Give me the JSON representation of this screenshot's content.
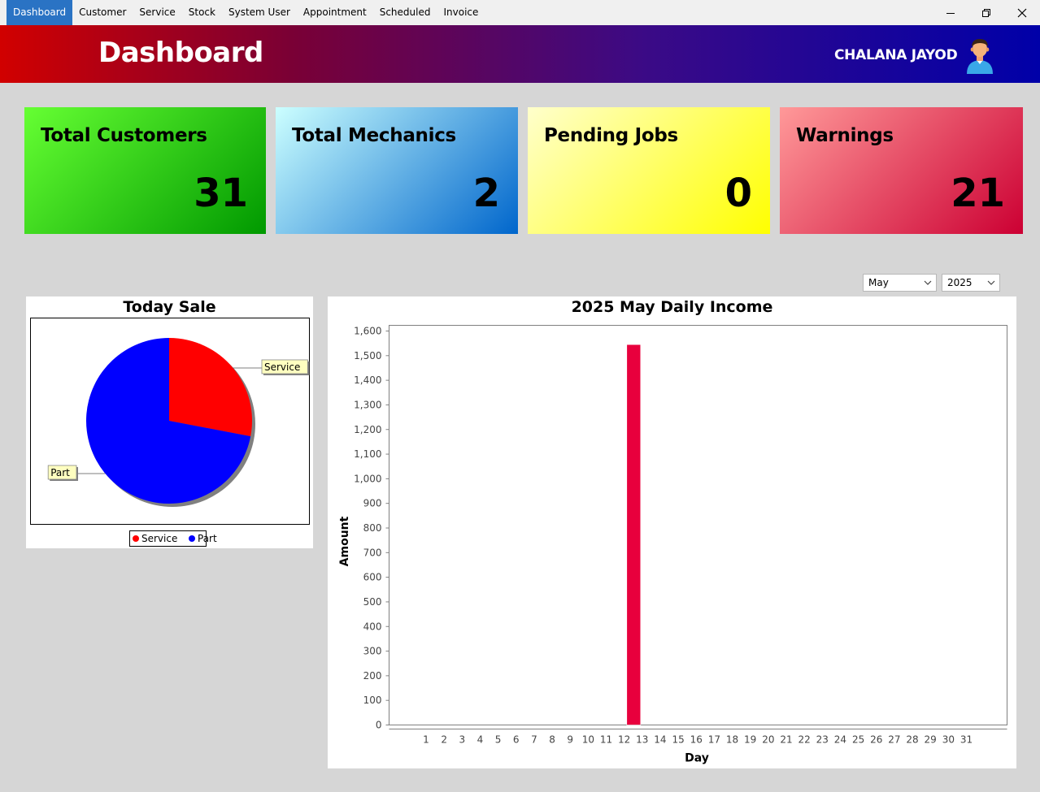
{
  "menu": {
    "items": [
      "Dashboard",
      "Customer",
      "Service",
      "Stock",
      "System User",
      "Appointment",
      "Scheduled",
      "Invoice"
    ],
    "active_index": 0
  },
  "window_controls": {
    "minimize_icon": "minimize-icon",
    "restore_icon": "restore-icon",
    "close_icon": "close-icon"
  },
  "header": {
    "title": "Dashboard",
    "user_name": "CHALANA JAYOD",
    "avatar_icon": "user-avatar-icon"
  },
  "cards": {
    "customers": {
      "label": "Total Customers",
      "value": "31"
    },
    "mechanics": {
      "label": "Total Mechanics",
      "value": "2"
    },
    "pending": {
      "label": "Pending Jobs",
      "value": "0"
    },
    "warnings": {
      "label": "Warnings",
      "value": "21"
    }
  },
  "filters": {
    "month": "May",
    "year": "2025"
  },
  "chart_data": [
    {
      "type": "pie",
      "title": "Today Sale",
      "slices": [
        {
          "name": "Service",
          "value": 28,
          "color": "#ff0000"
        },
        {
          "name": "Part",
          "value": 72,
          "color": "#0000ff"
        }
      ],
      "legend": [
        "Service",
        "Part"
      ],
      "legend_placement": "bottom"
    },
    {
      "type": "bar",
      "title": "2025 May Daily Income",
      "xlabel": "Day",
      "ylabel": "Amount",
      "categories": [
        "1",
        "2",
        "3",
        "4",
        "5",
        "6",
        "7",
        "8",
        "9",
        "10",
        "11",
        "12",
        "13",
        "14",
        "15",
        "16",
        "17",
        "18",
        "19",
        "20",
        "21",
        "22",
        "23",
        "24",
        "25",
        "26",
        "27",
        "28",
        "29",
        "30",
        "31"
      ],
      "values": [
        0,
        0,
        0,
        0,
        0,
        0,
        0,
        0,
        0,
        0,
        0,
        0,
        1545,
        0,
        0,
        0,
        0,
        0,
        0,
        0,
        0,
        0,
        0,
        0,
        0,
        0,
        0,
        0,
        0,
        0,
        0
      ],
      "ylim": [
        0,
        1600
      ],
      "yticks": [
        "0",
        "100",
        "200",
        "300",
        "400",
        "500",
        "600",
        "700",
        "800",
        "900",
        "1,000",
        "1,100",
        "1,200",
        "1,300",
        "1,400",
        "1,500",
        "1,600"
      ],
      "bar_color": "#e8003d",
      "grid": false
    }
  ]
}
